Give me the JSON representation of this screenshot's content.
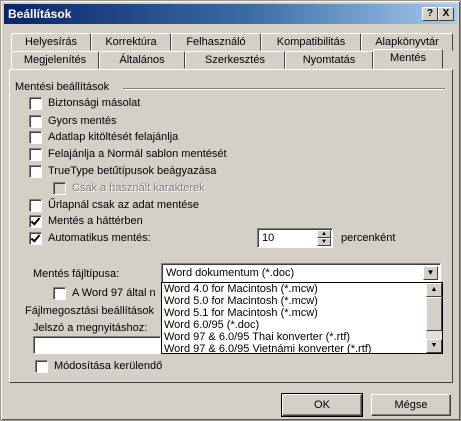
{
  "window": {
    "title": "Beállítások",
    "help_glyph": "?",
    "close_glyph": "X"
  },
  "tabs_back": [
    "Helyesírás",
    "Korrektúra",
    "Felhasználó",
    "Kompatibilitás",
    "Alapkönyvtár"
  ],
  "tabs_front": [
    "Megjelenítés",
    "Általános",
    "Szerkesztés",
    "Nyomtatás",
    "Mentés"
  ],
  "active_tab": "Mentés",
  "save_options": {
    "group_title": "Mentési beállítások",
    "items": [
      {
        "label": "Biztonsági másolat",
        "checked": false,
        "enabled": true
      },
      {
        "label": "Gyors mentés",
        "checked": false,
        "enabled": true
      },
      {
        "label": "Adatlap kitöltését felajánlja",
        "checked": false,
        "enabled": true
      },
      {
        "label": "Felajánlja a Normál sablon mentését",
        "checked": false,
        "enabled": true
      },
      {
        "label": "TrueType betűtípusok beágyazása",
        "checked": false,
        "enabled": true
      },
      {
        "label": "Csak a használt karakterek",
        "checked": false,
        "enabled": false
      },
      {
        "label": "Űrlapnál csak az adat mentése",
        "checked": false,
        "enabled": true
      },
      {
        "label": "Mentés a háttérben",
        "checked": true,
        "enabled": true
      },
      {
        "label": "Automatikus mentés:",
        "checked": true,
        "enabled": true
      }
    ],
    "autosave_value": "10",
    "autosave_unit": "percenként"
  },
  "file_type": {
    "label": "Mentés fájltípusa:",
    "selected": "Word dokumentum (*.doc)",
    "options": [
      "Word 4.0 for Macintosh (*.mcw)",
      "Word 5.0 for Macintosh (*.mcw)",
      "Word 5.1 for Macintosh (*.mcw)",
      "Word 6.0/95 (*.doc)",
      "Word 97 & 6.0/95 Thai konverter (*.rtf)",
      "Word 97 & 6.0/95 Vietnámi konverter (*.rtf)"
    ]
  },
  "word97_checkbox": {
    "label": "A Word 97 által n",
    "checked": false
  },
  "sharing": {
    "group_title": "Fájlmegosztási beállítások",
    "password_label": "Jelszó a megnyitáshoz:",
    "password_value": "",
    "avoid_edit_label": "Módosítása kerülendő",
    "avoid_edit_checked": false
  },
  "buttons": {
    "ok": "OK",
    "cancel": "Mégse"
  }
}
